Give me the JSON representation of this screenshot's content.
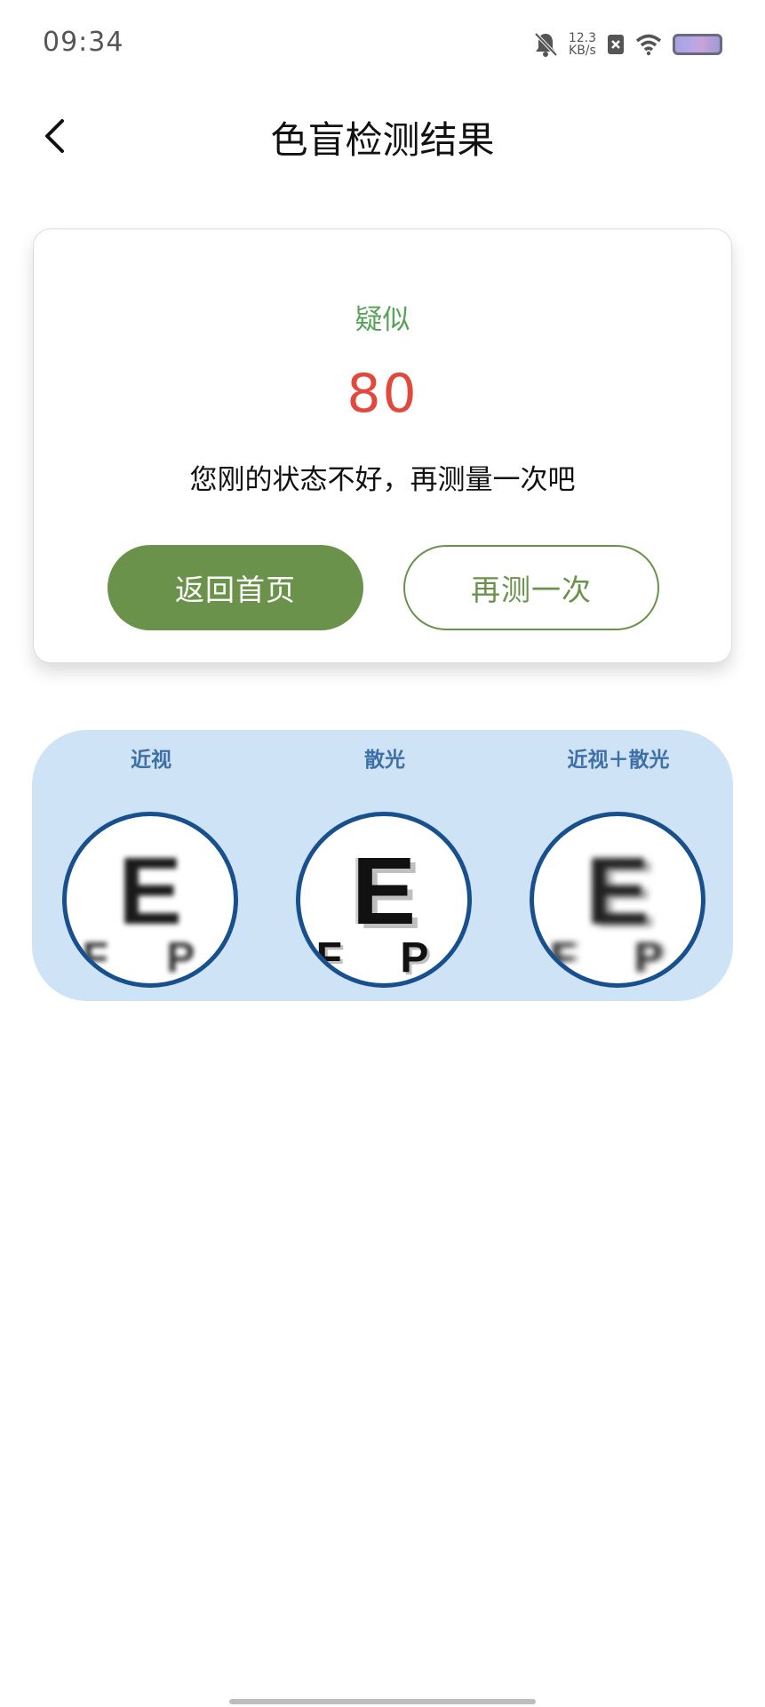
{
  "status_bar": {
    "time": "09:34",
    "net_speed_value": "12.3",
    "net_speed_unit": "KB/s"
  },
  "header": {
    "title": "色盲检测结果"
  },
  "result": {
    "label": "疑似",
    "score": "80",
    "message": "您刚的状态不好，再测量一次吧",
    "home_button": "返回首页",
    "retry_button": "再测一次"
  },
  "vision_illustration": {
    "items": [
      {
        "label": "近视",
        "letter": "E",
        "row": "F P"
      },
      {
        "label": "散光",
        "letter": "E",
        "row": "F P"
      },
      {
        "label": "近视＋散光",
        "letter": "E",
        "row": "F P"
      }
    ]
  },
  "colors": {
    "accent_green": "#6b924a",
    "label_green": "#58a25a",
    "score_red": "#e2483c",
    "panel_blue": "#cfe3f6",
    "circle_border": "#17508c"
  }
}
